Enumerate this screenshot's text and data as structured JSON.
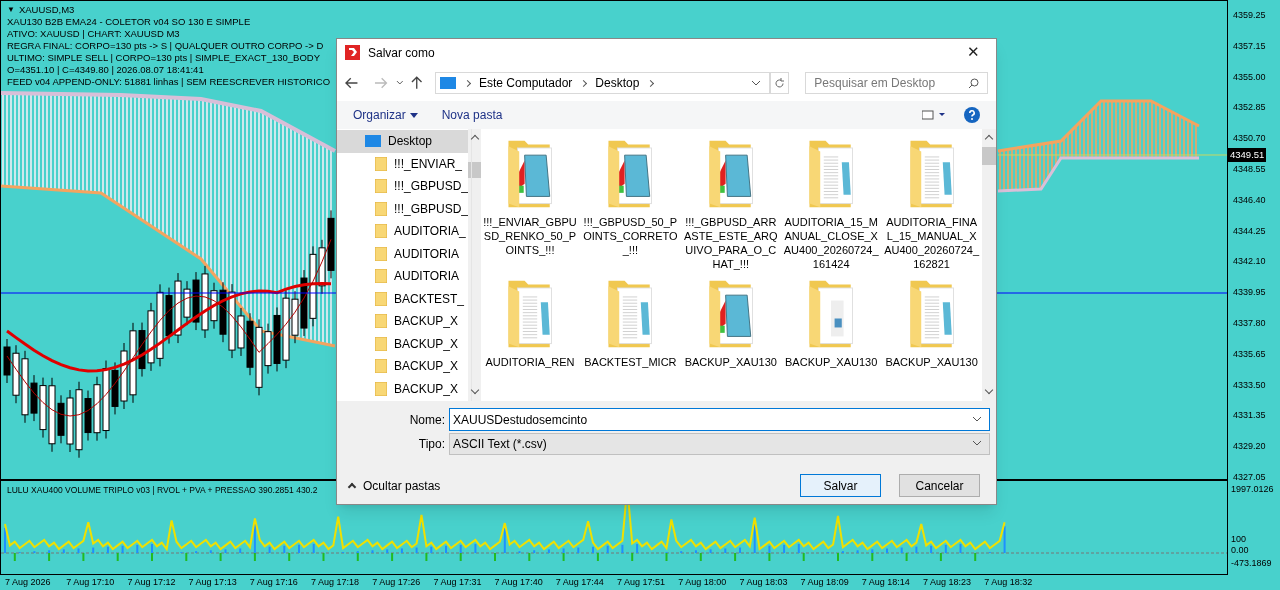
{
  "chart": {
    "symbol": "XAUUSD,M3",
    "collapse_glyph": "▼",
    "info_lines": [
      "XAU130 B2B EMA24 - COLETOR v04 SO 130 E SIMPLE",
      "ATIVO: XAUUSD | CHART: XAUUSD M3",
      "REGRA FINAL: CORPO=130 pts -> S | QUALQUER OUTRO CORPO -> D",
      "ULTIMO: SIMPLE SELL | CORPO=130 pts | SIMPLE_EXACT_130_BODY",
      "O=4351.10 | C=4349.80 | 2026.08.07 18:41:41",
      "FEED v04 APPEND-ONLY: 51881 linhas | SEM REESCREVER HISTORICO"
    ],
    "price_labels": [
      "4359.25",
      "4357.15",
      "4355.00",
      "4352.85",
      "4350.70",
      "4348.55",
      "4346.40",
      "4344.25",
      "4342.10",
      "4339.95",
      "4337.80",
      "4335.65",
      "4333.50",
      "4331.35",
      "4329.20",
      "4327.05"
    ],
    "current_price": "4349.51"
  },
  "indicator": {
    "title": "LULU XAU400 VOLUME TRIPLO v03 | RVOL + PVA + PRESSAO 390.2851 430.2",
    "labels": [
      "1997.0126",
      "100",
      "0.00",
      "-473.1869"
    ]
  },
  "time_labels": [
    "7 Aug 2026",
    "7 Aug 17:10",
    "7 Aug 17:12",
    "7 Aug 17:13",
    "7 Aug 17:16",
    "7 Aug 17:18",
    "7 Aug 17:26",
    "7 Aug 17:31",
    "7 Aug 17:40",
    "7 Aug 17:44",
    "7 Aug 17:51",
    "7 Aug 18:00",
    "7 Aug 18:03",
    "7 Aug 18:09",
    "7 Aug 18:14",
    "7 Aug 18:23",
    "7 Aug 18:32"
  ],
  "dialog": {
    "title": "Salvar como",
    "close_glyph": "✕",
    "breadcrumbs": [
      "Este Computador",
      "Desktop"
    ],
    "search": {
      "placeholder": "Pesquisar em Desktop"
    },
    "toolbar": {
      "organize": "Organizar",
      "new_folder": "Nova pasta"
    },
    "tree": [
      {
        "label": "Desktop",
        "selected": true,
        "children": [
          {
            "label": "!!!_ENVIAR_",
            "selected": false
          },
          {
            "label": "!!!_GBPUSD_",
            "selected": false
          },
          {
            "label": "!!!_GBPUSD_",
            "selected": false
          },
          {
            "label": "AUDITORIA_",
            "selected": false
          },
          {
            "label": "AUDITORIA",
            "selected": false
          },
          {
            "label": "AUDITORIA",
            "selected": false
          },
          {
            "label": "BACKTEST_",
            "selected": false
          },
          {
            "label": "BACKUP_X",
            "selected": false
          },
          {
            "label": "BACKUP_X",
            "selected": false
          },
          {
            "label": "BACKUP_X",
            "selected": false
          },
          {
            "label": "BACKUP_X",
            "selected": false
          }
        ]
      }
    ],
    "files": [
      {
        "name": "!!!_ENVIAR_GBPUSD_RENKO_50_POINTS_!!!",
        "kind": "notepad"
      },
      {
        "name": "!!!_GBPUSD_50_POINTS_CORRETO_!!!",
        "kind": "notepad"
      },
      {
        "name": "!!!_GBPUSD_ARRASTE_ESTE_ARQUIVO_PARA_O_CHAT_!!!",
        "kind": "notepad"
      },
      {
        "name": "AUDITORIA_15_MANUAL_CLOSE_XAU400_20260724_161424",
        "kind": "documents"
      },
      {
        "name": "AUDITORIA_FINAL_15_MANUAL_XAU400_20260724_162821",
        "kind": "documents"
      },
      {
        "name": "AUDITORIA_REN",
        "kind": "documents"
      },
      {
        "name": "BACKTEST_MICR",
        "kind": "documents"
      },
      {
        "name": "BACKUP_XAU130",
        "kind": "notepad"
      },
      {
        "name": "BACKUP_XAU130",
        "kind": "image"
      },
      {
        "name": "BACKUP_XAU130",
        "kind": "documents"
      }
    ],
    "name_field": {
      "label": "Nome:",
      "value": "XAUUSDestudosemcinto"
    },
    "type_field": {
      "label": "Tipo:",
      "value": "ASCII Text (*.csv)"
    },
    "hide_folders": "Ocultar pastas",
    "buttons": [
      {
        "label": "Salvar",
        "default": true
      },
      {
        "label": "Cancelar",
        "default": false
      }
    ]
  }
}
